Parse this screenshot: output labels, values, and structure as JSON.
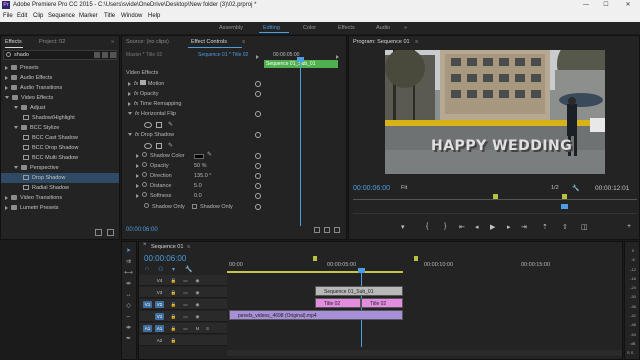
{
  "app": {
    "logo": "Pr",
    "title": "Adobe Premiere Pro CC 2015 - C:\\Users\\svide\\OneDrive\\Desktop\\New folder (3)\\02.prproj *",
    "window_controls": {
      "minimize": "—",
      "maximize": "☐",
      "close": "✕"
    }
  },
  "menu": [
    "File",
    "Edit",
    "Clip",
    "Sequence",
    "Marker",
    "Title",
    "Window",
    "Help"
  ],
  "workspaces": {
    "items": [
      "Assembly",
      "Editing",
      "Color",
      "Effects",
      "Audio"
    ],
    "active": "Editing",
    "more": "»"
  },
  "effects_panel": {
    "tabs": [
      "Effects",
      "Project: 02"
    ],
    "more": "»",
    "search_value": "shado",
    "items": [
      {
        "label": "Presets",
        "type": "folder",
        "expanded": false
      },
      {
        "label": "Audio Effects",
        "type": "folder",
        "expanded": false
      },
      {
        "label": "Audio Transitions",
        "type": "folder",
        "expanded": false
      },
      {
        "label": "Video Effects",
        "type": "folder",
        "expanded": true
      },
      {
        "label": "Adjust",
        "type": "folder",
        "expanded": true
      },
      {
        "label": "Shadow/Highlight",
        "type": "effect"
      },
      {
        "label": "BCC Stylize",
        "type": "folder",
        "expanded": true
      },
      {
        "label": "BCC Cast Shadow",
        "type": "effect"
      },
      {
        "label": "BCC Drop Shadow",
        "type": "effect"
      },
      {
        "label": "BCC Multi Shadow",
        "type": "effect"
      },
      {
        "label": "Perspective",
        "type": "folder",
        "expanded": true
      },
      {
        "label": "Drop Shadow",
        "type": "effect",
        "selected": true
      },
      {
        "label": "Radial Shadow",
        "type": "effect"
      },
      {
        "label": "Video Transitions",
        "type": "folder",
        "expanded": false
      },
      {
        "label": "Lumetri Presets",
        "type": "folder",
        "expanded": false
      }
    ]
  },
  "effect_controls": {
    "tabs": [
      "Source: (no clips)",
      "Effect Controls"
    ],
    "menu": "≡",
    "master": "Master * Title 02",
    "sequence_clip": "Sequence 01 * Title 02",
    "clip_label": "Sequence 01_Sub_01",
    "ruler_time": "00:00:05:00",
    "section": "Video Effects",
    "rows": [
      {
        "label": "Motion"
      },
      {
        "label": "Opacity"
      },
      {
        "label": "Time Remapping"
      },
      {
        "label": "Horizontal Flip"
      },
      {
        "label": "Drop Shadow"
      }
    ],
    "params": [
      {
        "label": "Shadow Color",
        "value": ""
      },
      {
        "label": "Opacity",
        "value": "50 %"
      },
      {
        "label": "Direction",
        "value": "135.0 °"
      },
      {
        "label": "Distance",
        "value": "5.0"
      },
      {
        "label": "Softness",
        "value": "0.0"
      },
      {
        "label": "Shadow Only",
        "value": "Shadow Only"
      }
    ],
    "timecode": "00:00:06:00"
  },
  "program_monitor": {
    "title": "Program: Sequence 01",
    "menu": "≡",
    "overlay_text": "HAPPY WEDDING",
    "timecode": "00:00:06:00",
    "fit": "Fit",
    "page": "1/2",
    "duration": "00:00:12:01",
    "controls": [
      "marker",
      "in",
      "out",
      "go-in",
      "step-back",
      "play",
      "step-forward",
      "go-out",
      "lift",
      "extract",
      "export-frame",
      "more"
    ]
  },
  "timeline": {
    "tab": "Sequence 01",
    "menu": "≡",
    "timecode": "00:00:06:00",
    "ruler": [
      "00:00",
      "00:00:05:00",
      "00:00:10:00",
      "00:00:15:00"
    ],
    "tracks": [
      {
        "label": "V4"
      },
      {
        "label": "V3"
      },
      {
        "label": "V2"
      },
      {
        "label": "V1"
      },
      {
        "label": "A1"
      },
      {
        "label": "A2"
      }
    ],
    "clips": [
      {
        "label": "Sequence 01_Sub_01",
        "color": "#b8b8b8"
      },
      {
        "label": "Title 02",
        "color": "#e38de0"
      },
      {
        "label": "Title 02",
        "color": "#e38de0"
      },
      {
        "label": "pexels_videos_4698 (Original).mp4",
        "color": "#a88fd9"
      }
    ],
    "meter_labels": [
      "0",
      "-6",
      "-12",
      "-18",
      "-24",
      "-30",
      "-36",
      "-42",
      "-48",
      "-54",
      "dB"
    ],
    "meter_footer": "S S"
  },
  "colors": {
    "accent": "#4d9de0",
    "clip_pink": "#e38de0",
    "clip_purple": "#a88fd9",
    "playhead": "#4d9de0"
  }
}
